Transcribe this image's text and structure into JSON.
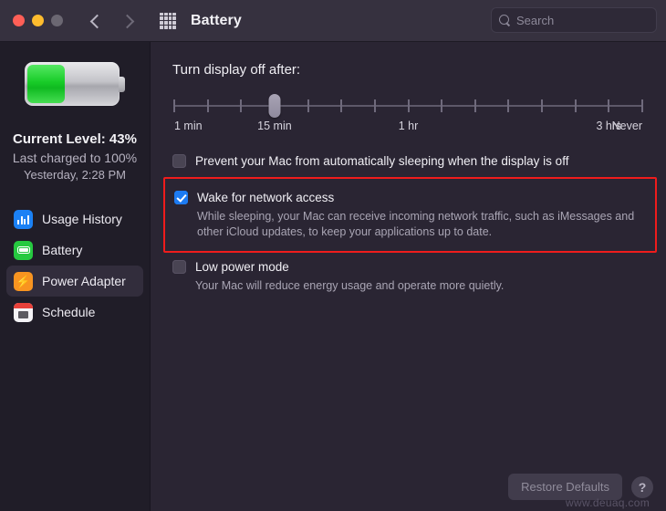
{
  "window": {
    "title": "Battery",
    "traffic_lights": [
      "close-red",
      "minimize-yellow",
      "zoom-gray"
    ],
    "back_label": "Back",
    "forward_label": "Forward",
    "show_all_label": "Show All"
  },
  "search": {
    "placeholder": "Search",
    "value": ""
  },
  "sidebar": {
    "battery": {
      "level_percent": 43,
      "current_level": "Current Level: 43%",
      "last_charged": "Last charged to 100%",
      "last_charged_time": "Yesterday, 2:28 PM"
    },
    "items": [
      {
        "label": "Usage History",
        "icon": "usage-history-icon",
        "selected": false
      },
      {
        "label": "Battery",
        "icon": "battery-icon",
        "selected": false
      },
      {
        "label": "Power Adapter",
        "icon": "power-adapter-icon",
        "selected": true
      },
      {
        "label": "Schedule",
        "icon": "schedule-icon",
        "selected": false
      }
    ]
  },
  "main": {
    "display_off_label": "Turn display off after:",
    "slider": {
      "tick_count": 15,
      "thumb_index": 3,
      "labels": [
        {
          "text": "1 min",
          "pos": 0
        },
        {
          "text": "15 min",
          "pos": 3
        },
        {
          "text": "1 hr",
          "pos": 7
        },
        {
          "text": "3 hrs",
          "pos": 13
        },
        {
          "text": "Never",
          "pos": 14
        }
      ]
    },
    "options": [
      {
        "label": "Prevent your Mac from automatically sleeping when the display is off",
        "checked": false,
        "description": "",
        "highlighted": false
      },
      {
        "label": "Wake for network access",
        "checked": true,
        "description": "While sleeping, your Mac can receive incoming network traffic, such as iMessages and other iCloud updates, to keep your applications up to date.",
        "highlighted": true
      },
      {
        "label": "Low power mode",
        "checked": false,
        "description": "Your Mac will reduce energy usage and operate more quietly.",
        "highlighted": false
      }
    ]
  },
  "footer": {
    "restore_defaults": "Restore Defaults",
    "help": "?"
  },
  "watermark": "www.deuaq.com",
  "colors": {
    "accent_blue": "#1d7bf2",
    "highlight_red": "#ef1c1c",
    "battery_green": "#18cc28",
    "power_orange": "#f89420",
    "sidebar_bg": "#201d28",
    "main_bg": "#2a2533",
    "titlebar_bg": "#36313f"
  }
}
